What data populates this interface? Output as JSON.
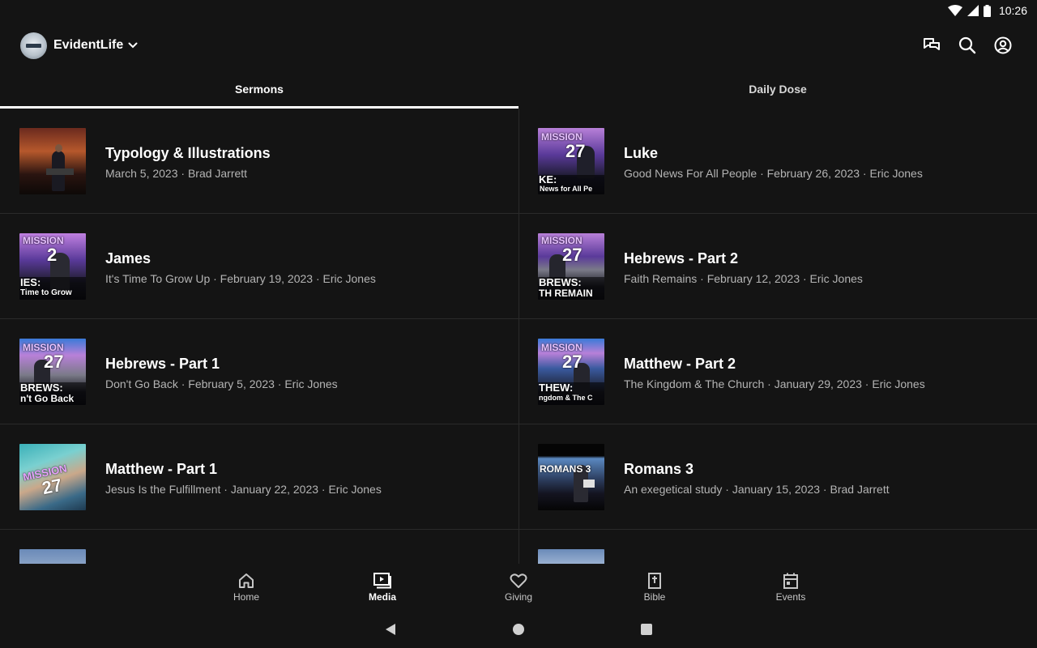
{
  "status": {
    "time": "10:26"
  },
  "header": {
    "brand": "EvidentLife"
  },
  "tabs": [
    {
      "label": "Sermons",
      "active": true
    },
    {
      "label": "Daily Dose",
      "active": false
    }
  ],
  "sermons": [
    {
      "title": "Typology & Illustrations",
      "subtitle": "March 5, 2023 · Brad Jarrett",
      "thumb_text": ""
    },
    {
      "title": "Luke",
      "subtitle": "Good News For All People · February 26, 2023 · Eric Jones",
      "thumb_text": "MISSION 27 KE: News for All Pe"
    },
    {
      "title": "James",
      "subtitle": "It's Time To Grow Up · February 19, 2023 · Eric Jones",
      "thumb_text": "MISSION 2 IES: Time to Grow"
    },
    {
      "title": "Hebrews - Part 2",
      "subtitle": "Faith Remains · February 12, 2023 · Eric Jones",
      "thumb_text": "MISSION 27 BREWS: TH REMAIN"
    },
    {
      "title": "Hebrews - Part 1",
      "subtitle": "Don't Go Back · February 5, 2023 · Eric Jones",
      "thumb_text": "MISSION 27 BREWS: n't Go Back"
    },
    {
      "title": "Matthew - Part 2",
      "subtitle": "The Kingdom & The Church · January 29, 2023 · Eric Jones",
      "thumb_text": "MISSION 27 THEW: ngdom & The C"
    },
    {
      "title": "Matthew - Part 1",
      "subtitle": "Jesus Is the Fulfillment · January 22, 2023 · Eric Jones",
      "thumb_text": "MISSION 27"
    },
    {
      "title": "Romans 3",
      "subtitle": "An exegetical study · January 15, 2023 · Brad Jarrett",
      "thumb_text": "ROMANS 3"
    }
  ],
  "bottom_nav": [
    {
      "label": "Home",
      "icon": "home-icon",
      "active": false
    },
    {
      "label": "Media",
      "icon": "media-icon",
      "active": true
    },
    {
      "label": "Giving",
      "icon": "heart-icon",
      "active": false
    },
    {
      "label": "Bible",
      "icon": "bible-icon",
      "active": false
    },
    {
      "label": "Events",
      "icon": "calendar-icon",
      "active": false
    }
  ]
}
